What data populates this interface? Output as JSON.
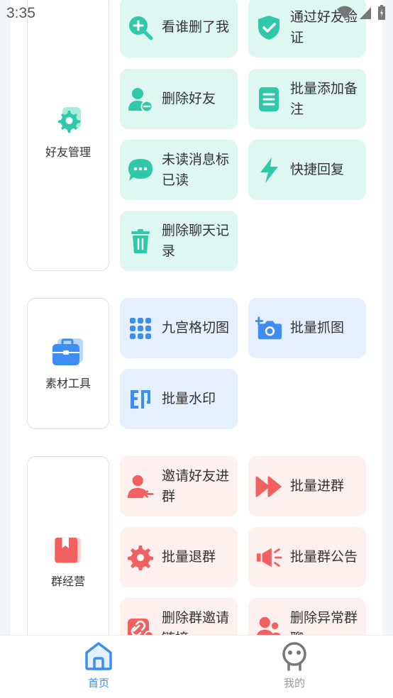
{
  "status_bar": {
    "time": "3:35"
  },
  "sections": [
    {
      "name": "好友管理",
      "color": "#2fc8a8",
      "tiles": [
        {
          "label": "看谁删了我",
          "icon": "search-plus-icon"
        },
        {
          "label": "通过好友验证",
          "icon": "shield-check-icon"
        },
        {
          "label": "删除好友",
          "icon": "user-minus-icon"
        },
        {
          "label": "批量添加备注",
          "icon": "document-icon"
        },
        {
          "label": "未读消息标已读",
          "icon": "chat-bubble-icon"
        },
        {
          "label": "快捷回复",
          "icon": "lightning-icon"
        },
        {
          "label": "删除聊天记录",
          "icon": "trash-icon"
        }
      ]
    },
    {
      "name": "素材工具",
      "color": "#3d8ef0",
      "tiles": [
        {
          "label": "九宫格切图",
          "icon": "grid-icon"
        },
        {
          "label": "批量抓图",
          "icon": "camera-plus-icon"
        },
        {
          "label": "批量水印",
          "icon": "stamp-icon"
        }
      ]
    },
    {
      "name": "群经营",
      "color": "#f26060",
      "tiles": [
        {
          "label": "邀请好友进群",
          "icon": "user-invite-icon"
        },
        {
          "label": "批量进群",
          "icon": "fast-forward-icon"
        },
        {
          "label": "批量退群",
          "icon": "gear-icon"
        },
        {
          "label": "批量群公告",
          "icon": "megaphone-icon"
        },
        {
          "label": "删除群邀请链接",
          "icon": "link-icon"
        },
        {
          "label": "删除异常群聊",
          "icon": "users-icon"
        }
      ]
    }
  ],
  "tabbar": {
    "home": {
      "label": "首页",
      "color": "#3d8ef0"
    },
    "mine": {
      "label": "我的",
      "color": "#999999"
    }
  }
}
